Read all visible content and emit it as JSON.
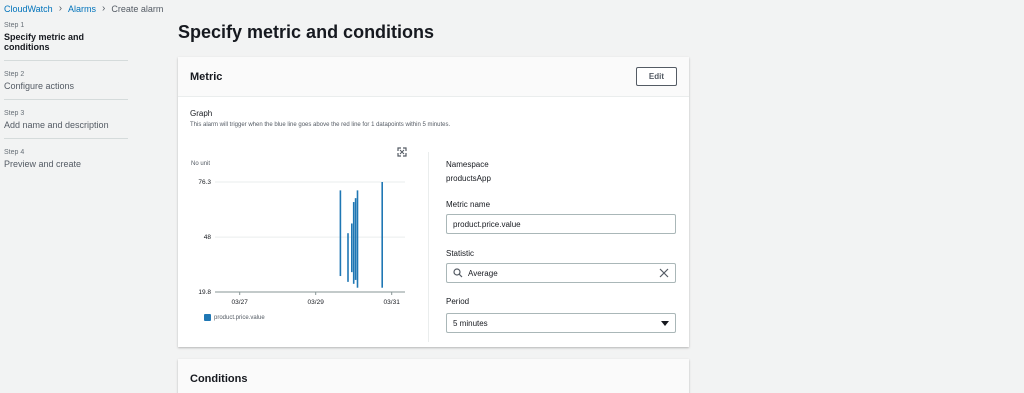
{
  "breadcrumb": {
    "items": [
      "CloudWatch",
      "Alarms",
      "Create alarm"
    ]
  },
  "steps": [
    {
      "num": "Step 1",
      "label": "Specify metric and conditions"
    },
    {
      "num": "Step 2",
      "label": "Configure actions"
    },
    {
      "num": "Step 3",
      "label": "Add name and description"
    },
    {
      "num": "Step 4",
      "label": "Preview and create"
    }
  ],
  "page": {
    "title": "Specify metric and conditions"
  },
  "metric_panel": {
    "title": "Metric",
    "edit_label": "Edit",
    "graph_title": "Graph",
    "graph_desc": "This alarm will trigger when the blue line goes above the red line for 1 datapoints within 5 minutes.",
    "no_unit": "No unit",
    "legend": "product.price.value",
    "namespace_label": "Namespace",
    "namespace_value": "productsApp",
    "metric_name_label": "Metric name",
    "metric_name_value": "product.price.value",
    "statistic_label": "Statistic",
    "statistic_value": "Average",
    "period_label": "Period",
    "period_value": "5 minutes"
  },
  "conditions_panel": {
    "title": "Conditions"
  },
  "colors": {
    "accent": "#0073bb",
    "series": "#1f77b4"
  },
  "chart_data": {
    "type": "line",
    "yticks": [
      "76.3",
      "48",
      "19.8"
    ],
    "xticks": [
      "03/27",
      "03/29",
      "03/31"
    ],
    "ylim": [
      19.8,
      76.3
    ],
    "series": [
      {
        "name": "product.price.value",
        "segments": [
          {
            "x": 0.66,
            "ymin": 28,
            "ymax": 72
          },
          {
            "x": 0.7,
            "ymin": 25,
            "ymax": 50
          },
          {
            "x": 0.72,
            "ymin": 30,
            "ymax": 55
          },
          {
            "x": 0.73,
            "ymin": 24,
            "ymax": 66
          },
          {
            "x": 0.74,
            "ymin": 26,
            "ymax": 68
          },
          {
            "x": 0.75,
            "ymin": 22,
            "ymax": 72
          },
          {
            "x": 0.88,
            "ymin": 22,
            "ymax": 76.3
          }
        ]
      }
    ]
  }
}
